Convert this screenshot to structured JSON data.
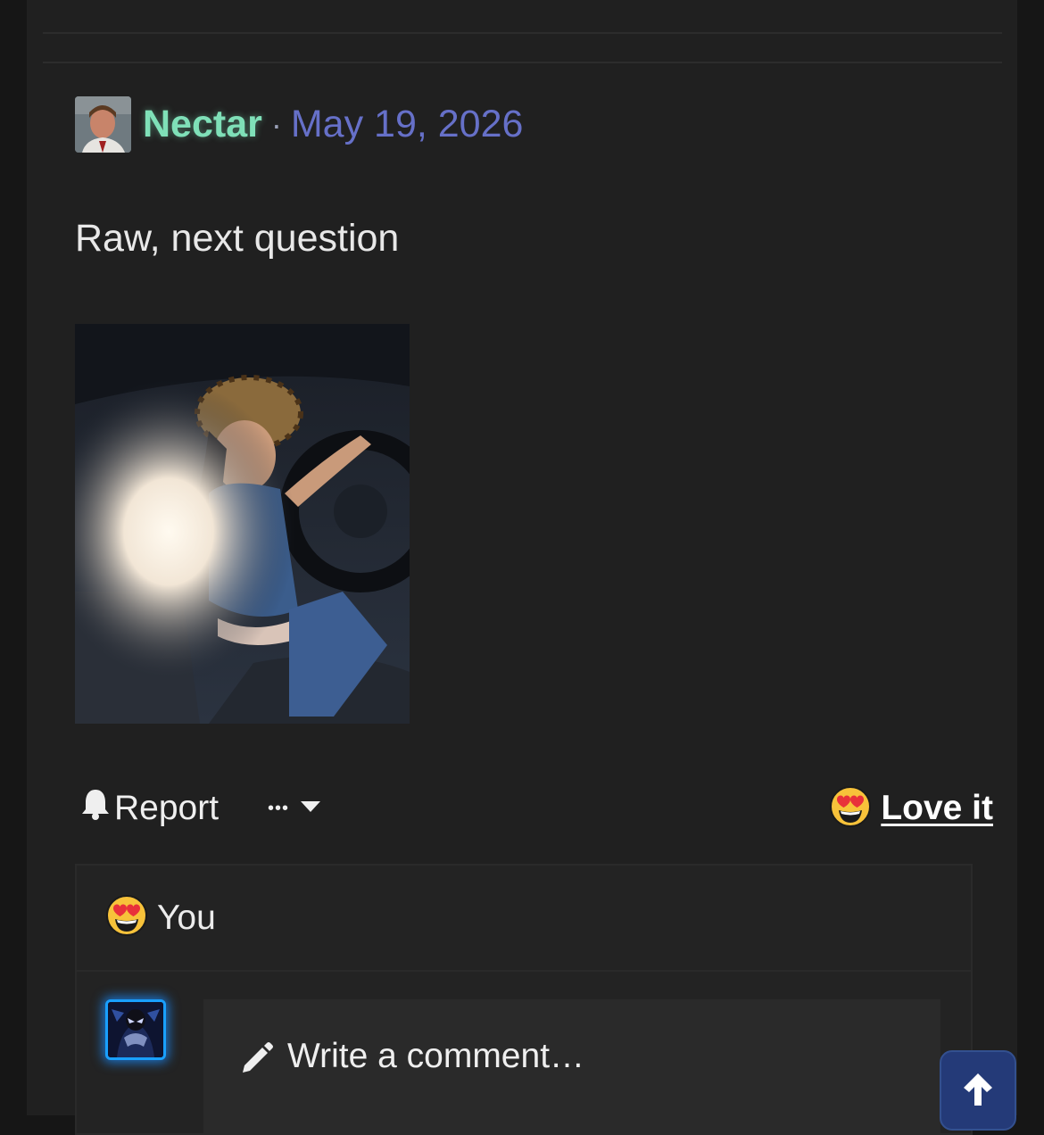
{
  "post": {
    "author": "Nectar",
    "separator": "·",
    "date": "May 19, 2026",
    "text": "Raw, next question"
  },
  "actions": {
    "report_label": "Report",
    "more_label": "•••",
    "reaction_label": "Love it"
  },
  "reactions": {
    "by_label": "You"
  },
  "comment": {
    "placeholder": "Write a comment…"
  },
  "icons": {
    "report": "bell-icon",
    "more": "caret-down-icon",
    "reaction": "heart-eyes-emoji",
    "comment": "pencil-icon",
    "scroll": "arrow-up-icon"
  },
  "colors": {
    "username": "#7fe0b8",
    "date": "#6670c8",
    "scroll_button": "#243a78",
    "avatar_ring": "#19a0ff"
  }
}
